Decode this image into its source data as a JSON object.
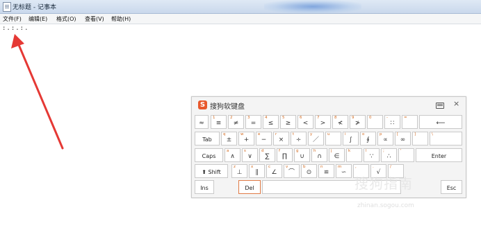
{
  "window": {
    "title": "无标题 - 记事本"
  },
  "menu": [
    "文件(F)",
    "编辑(E)",
    "格式(O)",
    "查看(V)",
    "帮助(H)"
  ],
  "editor": {
    "content": ":.:.:."
  },
  "keyboard": {
    "title": "搜狗软键盘",
    "logo": "S",
    "close": "×",
    "rows": [
      [
        {
          "sup": "",
          "sym": "≈"
        },
        {
          "sup": "1",
          "sym": "≡"
        },
        {
          "sup": "2",
          "sym": "≠"
        },
        {
          "sup": "3",
          "sym": "="
        },
        {
          "sup": "4",
          "sym": "≤"
        },
        {
          "sup": "5",
          "sym": "≥"
        },
        {
          "sup": "6",
          "sym": "<"
        },
        {
          "sup": "7",
          "sym": ">"
        },
        {
          "sup": "8",
          "sym": "≮"
        },
        {
          "sup": "9",
          "sym": "≯"
        },
        {
          "sup": "0",
          "sym": ""
        },
        {
          "sup": "-",
          "sym": "∷"
        },
        {
          "sup": "=",
          "sym": ""
        },
        {
          "sup": "",
          "sym": "⟵"
        }
      ],
      [
        {
          "sup": "",
          "sym": "Tab"
        },
        {
          "sup": "q",
          "sym": "±"
        },
        {
          "sup": "w",
          "sym": "+"
        },
        {
          "sup": "e",
          "sym": "−"
        },
        {
          "sup": "r",
          "sym": "×"
        },
        {
          "sup": "t",
          "sym": "÷"
        },
        {
          "sup": "y",
          "sym": "／"
        },
        {
          "sup": "u",
          "sym": ""
        },
        {
          "sup": "i",
          "sym": "∫"
        },
        {
          "sup": "o",
          "sym": "∮"
        },
        {
          "sup": "p",
          "sym": "∝"
        },
        {
          "sup": "[",
          "sym": "∞"
        },
        {
          "sup": "]",
          "sym": ""
        },
        {
          "sup": "\\",
          "sym": ""
        }
      ],
      [
        {
          "sup": "",
          "sym": "Caps"
        },
        {
          "sup": "a",
          "sym": "∧"
        },
        {
          "sup": "s",
          "sym": "∨"
        },
        {
          "sup": "d",
          "sym": "∑"
        },
        {
          "sup": "f",
          "sym": "∏"
        },
        {
          "sup": "g",
          "sym": "∪"
        },
        {
          "sup": "h",
          "sym": "∩"
        },
        {
          "sup": "j",
          "sym": "∈"
        },
        {
          "sup": "k",
          "sym": ""
        },
        {
          "sup": "l",
          "sym": "∵"
        },
        {
          "sup": ";",
          "sym": "∴"
        },
        {
          "sup": "'",
          "sym": ""
        },
        {
          "sup": "",
          "sym": "Enter"
        }
      ],
      [
        {
          "sup": "",
          "sym": "⬆ Shift"
        },
        {
          "sup": "z",
          "sym": "⊥"
        },
        {
          "sup": "x",
          "sym": "∥"
        },
        {
          "sup": "c",
          "sym": "∠"
        },
        {
          "sup": "v",
          "sym": "⌒"
        },
        {
          "sup": "b",
          "sym": "⊙"
        },
        {
          "sup": "n",
          "sym": "≌"
        },
        {
          "sup": "m",
          "sym": "∽"
        },
        {
          "sup": ",",
          "sym": ""
        },
        {
          "sup": ".",
          "sym": "√"
        },
        {
          "sup": "/",
          "sym": ""
        }
      ],
      [
        {
          "sup": "",
          "sym": "Ins"
        },
        {
          "sup": "",
          "sym": "Del"
        },
        {
          "sup": "",
          "sym": ""
        },
        {
          "sup": "",
          "sym": "Esc"
        }
      ]
    ]
  },
  "watermark": {
    "brand": "搜狗指南",
    "url": "zhinan.sogou.com"
  },
  "colors": {
    "arrow": "#e53935",
    "accent": "#e8582c",
    "superscript": "#d2691e"
  }
}
